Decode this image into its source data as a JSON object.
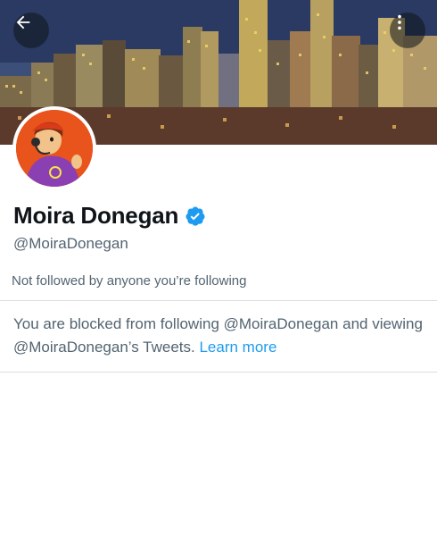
{
  "header": {
    "back_icon": "arrow-left-icon",
    "more_icon": "vertical-ellipsis-icon"
  },
  "profile": {
    "display_name": "Moira Donegan",
    "handle": "@MoiraDonegan",
    "verified": true,
    "followed_by_text": "Not followed by anyone you’re following"
  },
  "blocked_notice": {
    "text": "You are blocked from following @MoiraDonegan and viewing @MoiraDonegan’s Tweets.",
    "link_label": "Learn more"
  },
  "colors": {
    "link": "#1d9bf0",
    "verified_badge": "#1d9bf0",
    "secondary_text": "#536471",
    "avatar_bg": "#e8541c"
  }
}
